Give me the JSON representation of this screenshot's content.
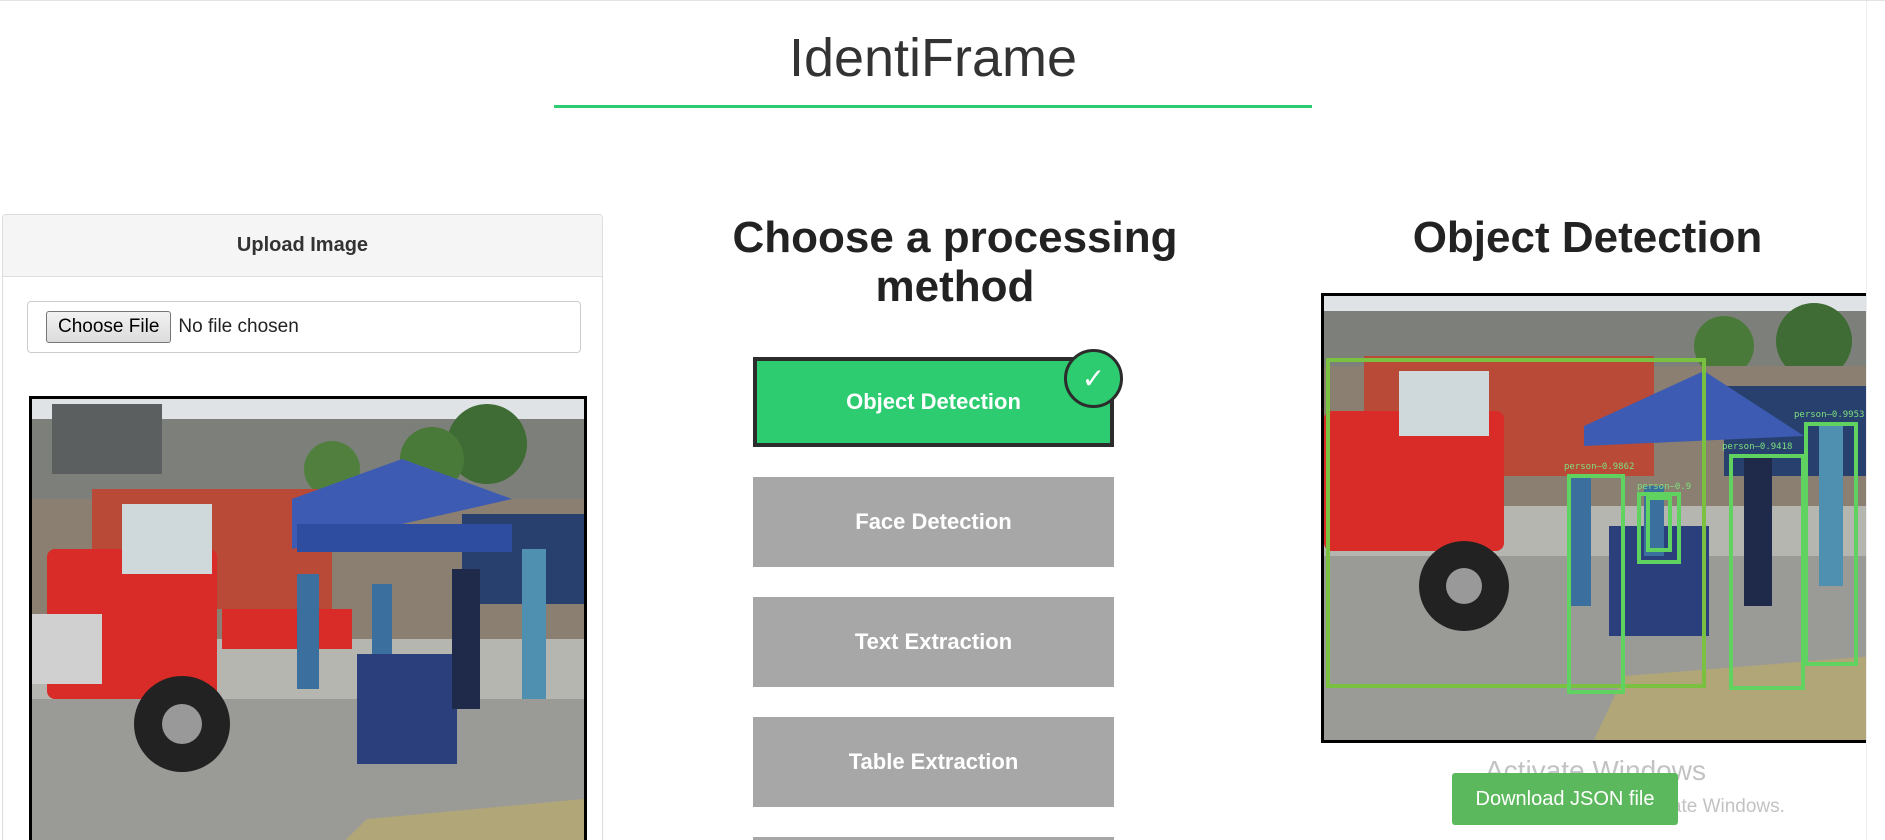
{
  "app": {
    "title": "IdentiFrame"
  },
  "upload": {
    "heading": "Upload Image",
    "choose_file_label": "Choose File",
    "file_status": "No file chosen"
  },
  "methods": {
    "heading": "Choose a processing method",
    "items": [
      {
        "label": "Object Detection",
        "active": true
      },
      {
        "label": "Face Detection",
        "active": false
      },
      {
        "label": "Text Extraction",
        "active": false
      },
      {
        "label": "Table Extraction",
        "active": false
      }
    ],
    "check_icon": "✓"
  },
  "result": {
    "heading": "Object Detection",
    "download_label": "Download JSON file",
    "detections": [
      "truck",
      "person",
      "person",
      "person",
      "person",
      "person"
    ],
    "labels": [
      "person—0.9862",
      "person—0.9418",
      "person—0.9953",
      "person—0.9"
    ]
  },
  "watermark": {
    "title": "Activate Windows",
    "subtitle": "Go to Settings to activate Windows."
  },
  "colors": {
    "accent": "#2ecc71",
    "inactive_button": "#a7a7a7",
    "download": "#5cb85c"
  }
}
